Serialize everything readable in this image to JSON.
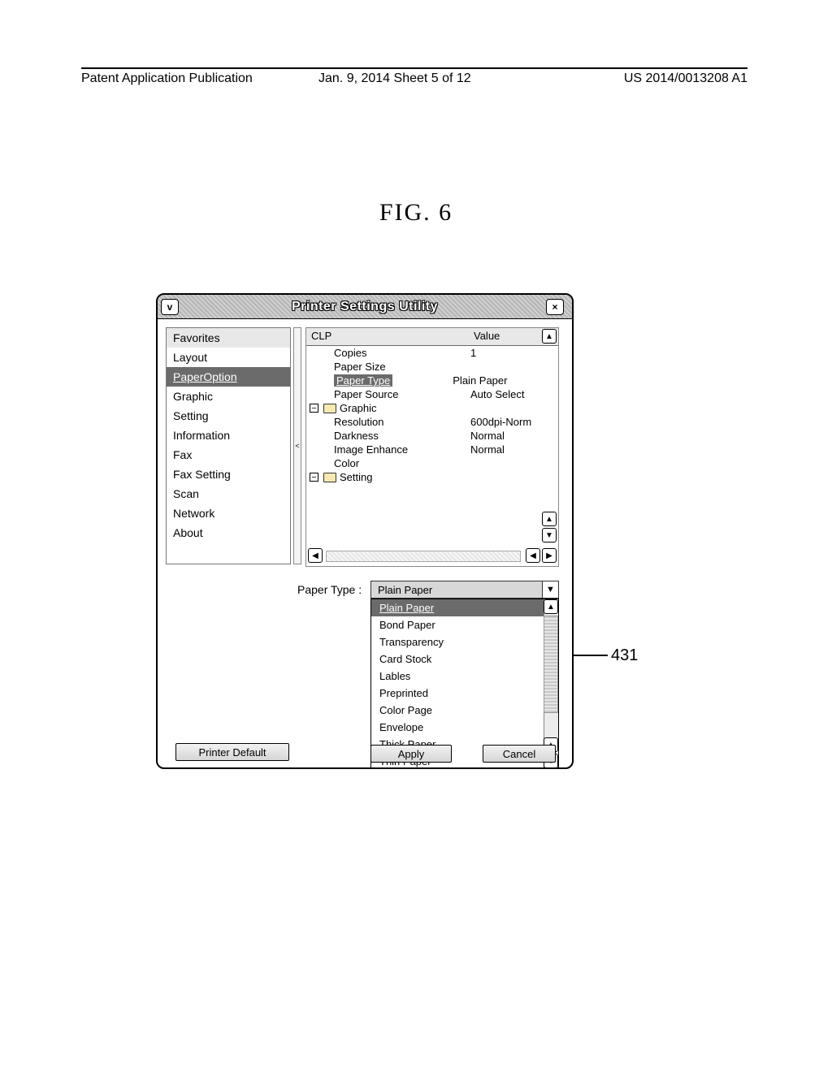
{
  "page_header": {
    "left": "Patent Application Publication",
    "middle": "Jan. 9, 2014  Sheet 5 of 12",
    "right": "US 2014/0013208 A1"
  },
  "figure_label": "FIG. 6",
  "window": {
    "title": "Printer Settings Utility",
    "menu_icon": "v",
    "close_icon": "×"
  },
  "sidebar": {
    "items": [
      {
        "label": "Favorites",
        "state": "faded"
      },
      {
        "label": "Layout",
        "state": ""
      },
      {
        "label": "PaperOption",
        "state": "selected"
      },
      {
        "label": "Graphic",
        "state": ""
      },
      {
        "label": "Setting",
        "state": ""
      },
      {
        "label": "Information",
        "state": ""
      },
      {
        "label": "Fax",
        "state": ""
      },
      {
        "label": "Fax Setting",
        "state": ""
      },
      {
        "label": "Scan",
        "state": ""
      },
      {
        "label": "Network",
        "state": ""
      },
      {
        "label": "About",
        "state": ""
      }
    ]
  },
  "tree_columns": {
    "col_a": "CLP",
    "col_b": "Value"
  },
  "tree": {
    "rows": [
      {
        "label": "Copies",
        "value": "1"
      },
      {
        "label": "Paper Size",
        "value": ""
      },
      {
        "label": "Paper Type",
        "value": "Plain Paper",
        "selected": true
      },
      {
        "label": "Paper Source",
        "value": "Auto Select"
      }
    ],
    "group_graphic": "Graphic",
    "graphic_rows": [
      {
        "label": "Resolution",
        "value": "600dpi-Norm"
      },
      {
        "label": "Darkness",
        "value": "Normal"
      },
      {
        "label": "Image Enhance",
        "value": "Normal"
      },
      {
        "label": "Color",
        "value": ""
      }
    ],
    "group_setting": "Setting"
  },
  "paper_type": {
    "label": "Paper Type :",
    "selected": "Plain Paper",
    "options": [
      "Plain Paper",
      "Bond Paper",
      "Transparency",
      "Card Stock",
      "Lables",
      "Preprinted",
      "Color Page",
      "Envelope",
      "Thick Paper",
      "Thin Paper"
    ]
  },
  "buttons": {
    "default": "Printer Default",
    "apply": "Apply",
    "cancel": "Cancel"
  },
  "callout": "431"
}
